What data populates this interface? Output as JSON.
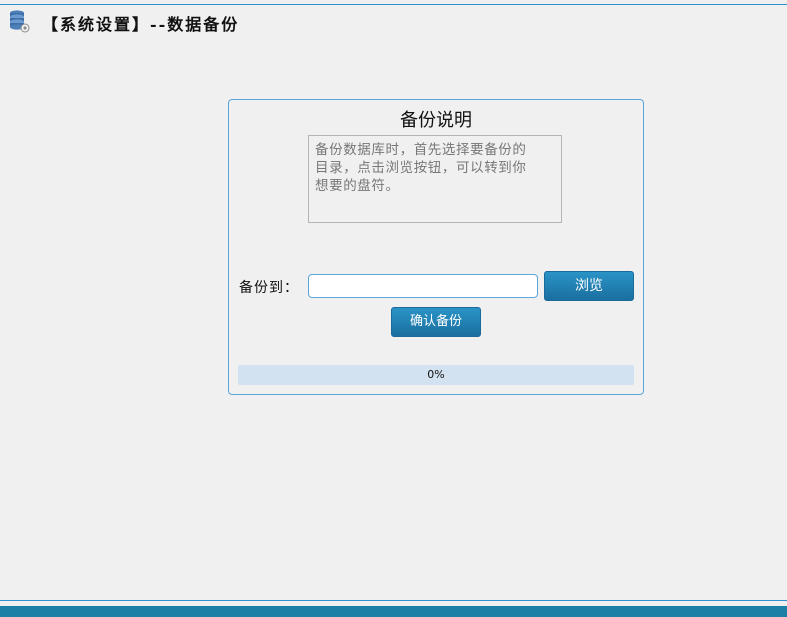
{
  "header": {
    "title": "【系统设置】--数据备份",
    "icon": "database-icon"
  },
  "panel": {
    "title": "备份说明",
    "description": "备份数据库时，首先选择要备份的\n目录，点击浏览按钮，可以转到你\n想要的盘符。",
    "target_label": "备份到：",
    "path_value": "",
    "browse_label": "浏览",
    "confirm_label": "确认备份",
    "progress": {
      "value": 0,
      "text": "0%"
    }
  },
  "colors": {
    "accent": "#1a6f9f",
    "border": "#5aa6dc",
    "progress_track": "#d3e2f0"
  }
}
